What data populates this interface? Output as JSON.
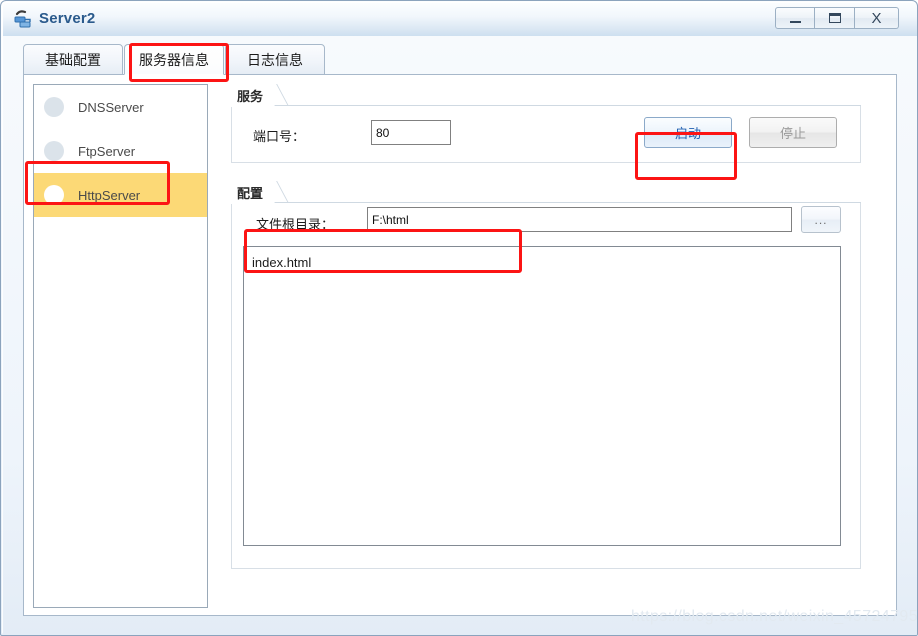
{
  "window": {
    "title": "Server2",
    "icon": "server-network-icon",
    "controls": {
      "minimize": "–",
      "maximize": "□",
      "close": "X"
    }
  },
  "tabs": [
    {
      "label": "基础配置",
      "selected": false
    },
    {
      "label": "服务器信息",
      "selected": true
    },
    {
      "label": "日志信息",
      "selected": false
    }
  ],
  "sidebar": {
    "items": [
      {
        "label": "DNSServer",
        "selected": false
      },
      {
        "label": "FtpServer",
        "selected": false
      },
      {
        "label": "HttpServer",
        "selected": true
      }
    ]
  },
  "service_group": {
    "title": "服务",
    "port_label": "端口号：",
    "port_value": "80",
    "port_placeholder": "",
    "start_button": "启动",
    "stop_button": "停止"
  },
  "config_group": {
    "title": "配置",
    "root_label": "文件根目录：",
    "root_value": "F:\\html",
    "root_placeholder": "",
    "browse_button": "...",
    "files": [
      "index.html"
    ]
  },
  "watermark": "https://blog.csdn.net/weixin_45724795",
  "colors": {
    "accent_blue": "#2a5a8c",
    "selection_yellow": "#fcd976",
    "annotation_red": "#fc1414",
    "enabled_button_text": "#1f5fb0",
    "disabled_button_text": "#9a9a9a"
  }
}
